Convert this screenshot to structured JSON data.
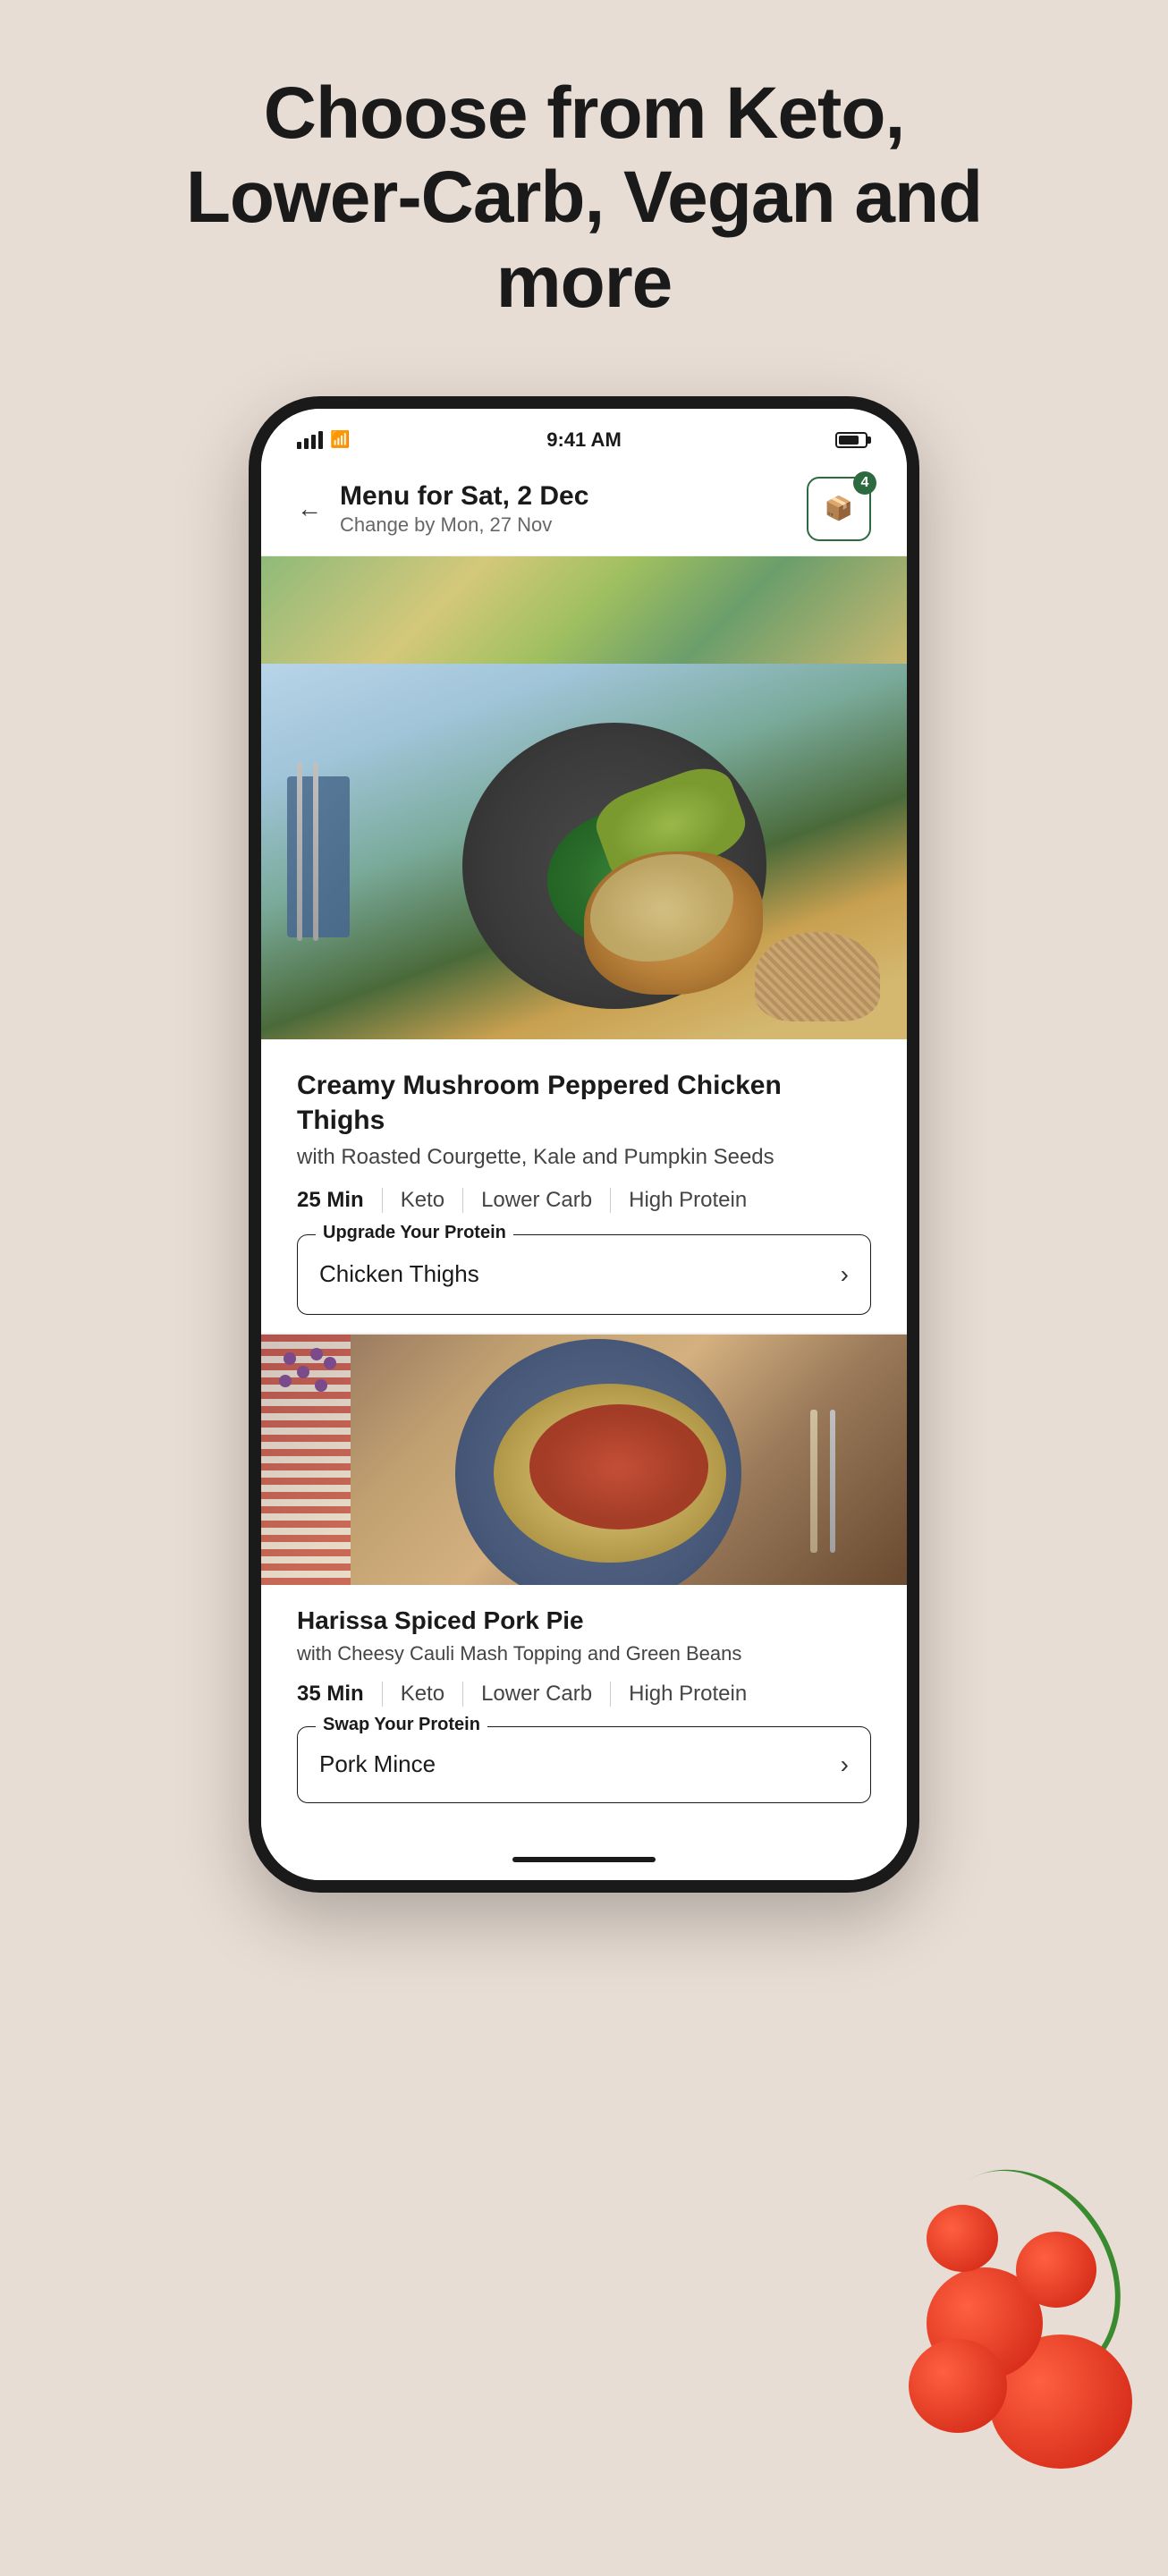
{
  "page": {
    "background_color": "#e8ddd4",
    "headline": "Choose from  Keto, Lower-Carb, Vegan and more"
  },
  "phone": {
    "status_bar": {
      "time": "9:41 AM"
    },
    "nav": {
      "back_label": "←",
      "title": "Menu for Sat, 2 Dec",
      "subtitle": "Change by Mon, 27 Nov",
      "box_count": "4"
    },
    "featured_meal": {
      "title": "Creamy Mushroom Peppered Chicken Thighs",
      "subtitle": "with Roasted Courgette, Kale and Pumpkin Seeds",
      "time": "25 Min",
      "tags": [
        "Keto",
        "Lower Carb",
        "High Protein"
      ],
      "protein_box_label": "Upgrade Your Protein",
      "protein_value": "Chicken Thighs"
    },
    "second_meal": {
      "title": "Harissa Spiced Pork Pie",
      "subtitle": "with Cheesy Cauli Mash Topping and Green Beans",
      "time": "35 Min",
      "tags": [
        "Keto",
        "Lower Carb",
        "High Protein"
      ],
      "swap_box_label": "Swap Your Protein",
      "swap_value": "Pork Mince"
    }
  }
}
